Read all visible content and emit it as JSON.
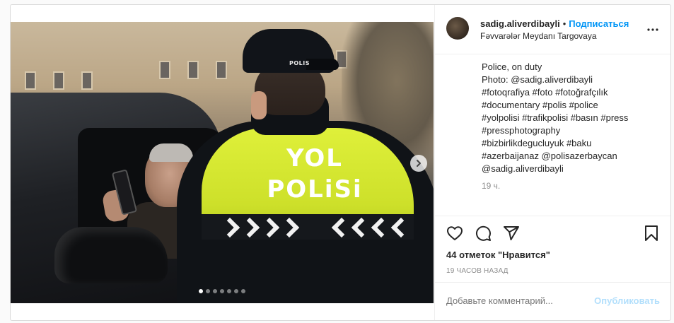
{
  "media": {
    "vest_text_line1": "YOL",
    "vest_text_line2": "POLiSi",
    "cap_text": "POLIS",
    "carousel_dots": 7,
    "active_dot": 0
  },
  "header": {
    "username": "sadig.aliverdibayli",
    "separator": "•",
    "follow_label": "Подписаться",
    "location": "Fəvvarələr Meydanı Targovaya"
  },
  "caption": {
    "lines": [
      "Police, on duty",
      "Photo: @sadig.aliverdibayli",
      "#fotoqrafiya #foto #fotoğrafçılık",
      "#documentary #polis #police",
      "#yolpolisi #trafikpolisi #basın #press",
      "#pressphotography",
      "#bizbirlikdegucluyuk #baku",
      "#azerbaijanaz @polisazerbaycan",
      "@sadig.aliverdibayli"
    ],
    "time": "19 ч."
  },
  "actions": {
    "likes": "44 отметок \"Нравится\"",
    "ago": "19 ЧАСОВ НАЗАД"
  },
  "comment": {
    "placeholder": "Добавьте комментарий...",
    "post_label": "Опубликовать"
  },
  "colors": {
    "accent": "#0095f6",
    "post_disabled": "#b2dffc",
    "text": "#262626",
    "muted": "#8e8e8e",
    "vest": "#dff03a"
  }
}
